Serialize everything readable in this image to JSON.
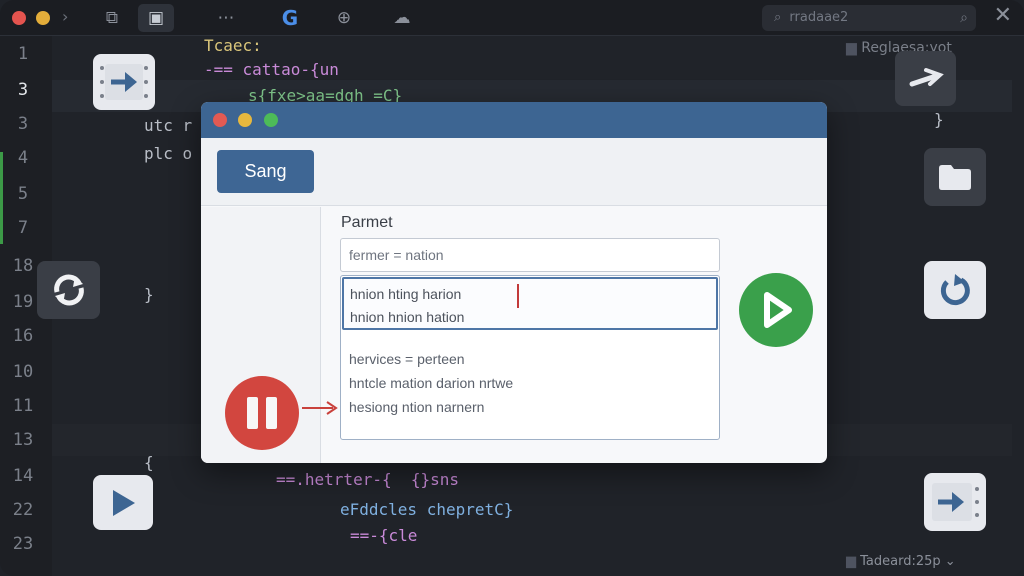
{
  "editor": {
    "search_text": "rradaae2",
    "line_numbers": [
      "1",
      "3",
      "3",
      "4",
      "5",
      "7",
      "18",
      "19",
      "16",
      "10",
      "11",
      "13",
      "14",
      "22",
      "23"
    ],
    "current_line_index": 1,
    "code_lines": [
      {
        "text": "Tcaec:",
        "color": "#d9c57a"
      },
      {
        "text": "-== cattao-{un",
        "color": "#c98ad8"
      },
      {
        "text": "s{fxe>aa=dgh =C}",
        "color": "#7fc58a"
      },
      {
        "text": "utc r",
        "color": "#b9bec7"
      },
      {
        "text": "plc o",
        "color": "#b9bec7"
      },
      {
        "text": "}",
        "color": "#b9bec7"
      },
      {
        "text": "{",
        "color": "#b9bec7"
      },
      {
        "text": "==.hetrter-{  {}sns",
        "color": "#c98ad8"
      },
      {
        "text": "eFddcles chepretC}",
        "color": "#7fb0e0"
      },
      {
        "text": "==-{cle",
        "color": "#c98ad8"
      },
      {
        "text": "}",
        "color": "#b9bec7"
      }
    ],
    "right_panel_label": "Reglaesa:yot",
    "status_text": "Tadeard:25p"
  },
  "dialog": {
    "send_label": "Sang",
    "param_label": "Parmet",
    "input_value": "fermer = nation",
    "list_selected": [
      "hnion hting harion",
      "hnion hnion hation"
    ],
    "list_items": [
      "hervices = perteen",
      "hntcle mation darion nrtwe",
      "hesiong ntion narnern"
    ]
  },
  "colors": {
    "dialog_titlebar": "#3d6592",
    "send_button": "#3e6694",
    "pause_button": "#d2463f",
    "play_button": "#3aa04b",
    "git_added": "#3c9a47"
  }
}
